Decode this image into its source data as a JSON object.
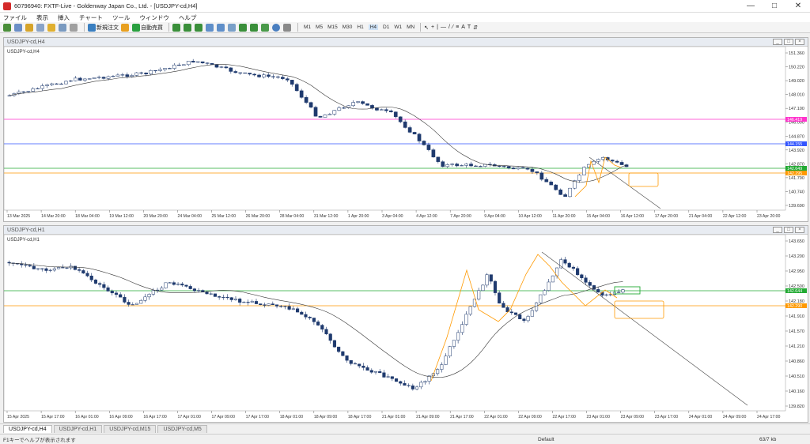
{
  "window": {
    "title": "60796940: FXTF-Live - Goldenway Japan Co., Ltd. - [USDJPY-cd,H4]"
  },
  "menu": [
    "ファイル",
    "表示",
    "挿入",
    "チャート",
    "ツール",
    "ウィンドウ",
    "ヘルプ"
  ],
  "toolbar": {
    "new_order": "新規注文",
    "auto_trade": "自動売買",
    "timeframes": [
      "M1",
      "M5",
      "M15",
      "M30",
      "H1",
      "H4",
      "D1",
      "W1",
      "MN"
    ],
    "active_tf": "H4"
  },
  "pane1": {
    "window_title": "USDJPY-cd,H4",
    "label": "USDJPY-cd,H4",
    "price_ticks": [
      "151.360",
      "150.220",
      "149.020",
      "148.010",
      "147.100",
      "146.000",
      "144.870",
      "143.920",
      "142.870",
      "141.790",
      "140.740",
      "139.690"
    ],
    "hlines": [
      {
        "label": "146.419",
        "color": "#ff33cc"
      },
      {
        "label": "144.155",
        "color": "#3355ff"
      },
      {
        "label": "142.649",
        "color": "#22aa33"
      },
      {
        "label": "142.295",
        "color": "#ff9900"
      }
    ],
    "time_ticks": [
      "13 Mar 2025",
      "14 Mar 20:00",
      "18 Mar 04:00",
      "19 Mar 12:00",
      "20 Mar 20:00",
      "24 Mar 04:00",
      "25 Mar 12:00",
      "26 Mar 20:00",
      "28 Mar 04:00",
      "31 Mar 12:00",
      "1 Apr 20:00",
      "3 Apr 04:00",
      "4 Apr 12:00",
      "7 Apr 20:00",
      "9 Apr 04:00",
      "10 Apr 12:00",
      "11 Apr 20:00",
      "15 Apr 04:00",
      "16 Apr 12:00",
      "17 Apr 20:00",
      "21 Apr 04:00",
      "22 Apr 12:00",
      "23 Apr 20:00"
    ]
  },
  "pane2": {
    "window_title": "USDJPY-cd,H1",
    "label": "USDJPY-cd,H1",
    "price_ticks": [
      "143.650",
      "143.200",
      "142.950",
      "142.500",
      "142.180",
      "141.910",
      "141.570",
      "141.210",
      "140.860",
      "140.510",
      "140.160",
      "139.820"
    ],
    "hlines": [
      {
        "label": "142.644",
        "color": "#22aa33"
      },
      {
        "label": "142.290",
        "color": "#ff9900"
      }
    ],
    "time_ticks": [
      "15 Apr 2025",
      "15 Apr 17:00",
      "16 Apr 01:00",
      "16 Apr 09:00",
      "16 Apr 17:00",
      "17 Apr 01:00",
      "17 Apr 09:00",
      "17 Apr 17:00",
      "18 Apr 01:00",
      "18 Apr 09:00",
      "18 Apr 17:00",
      "21 Apr 01:00",
      "21 Apr 09:00",
      "21 Apr 17:00",
      "22 Apr 01:00",
      "22 Apr 09:00",
      "22 Apr 17:00",
      "23 Apr 01:00",
      "23 Apr 09:00",
      "23 Apr 17:00",
      "24 Apr 01:00",
      "24 Apr 09:00",
      "24 Apr 17:00"
    ]
  },
  "tabs": [
    "USDJPY-cd,H4",
    "USDJPY-cd,H1",
    "USDJPY-cd,M15",
    "USDJPY-cd,M5"
  ],
  "active_tab": "USDJPY-cd,H4",
  "status": {
    "left": "F1キーでヘルプが表示されます",
    "default": "Default",
    "conn": "63/7 kb"
  }
}
